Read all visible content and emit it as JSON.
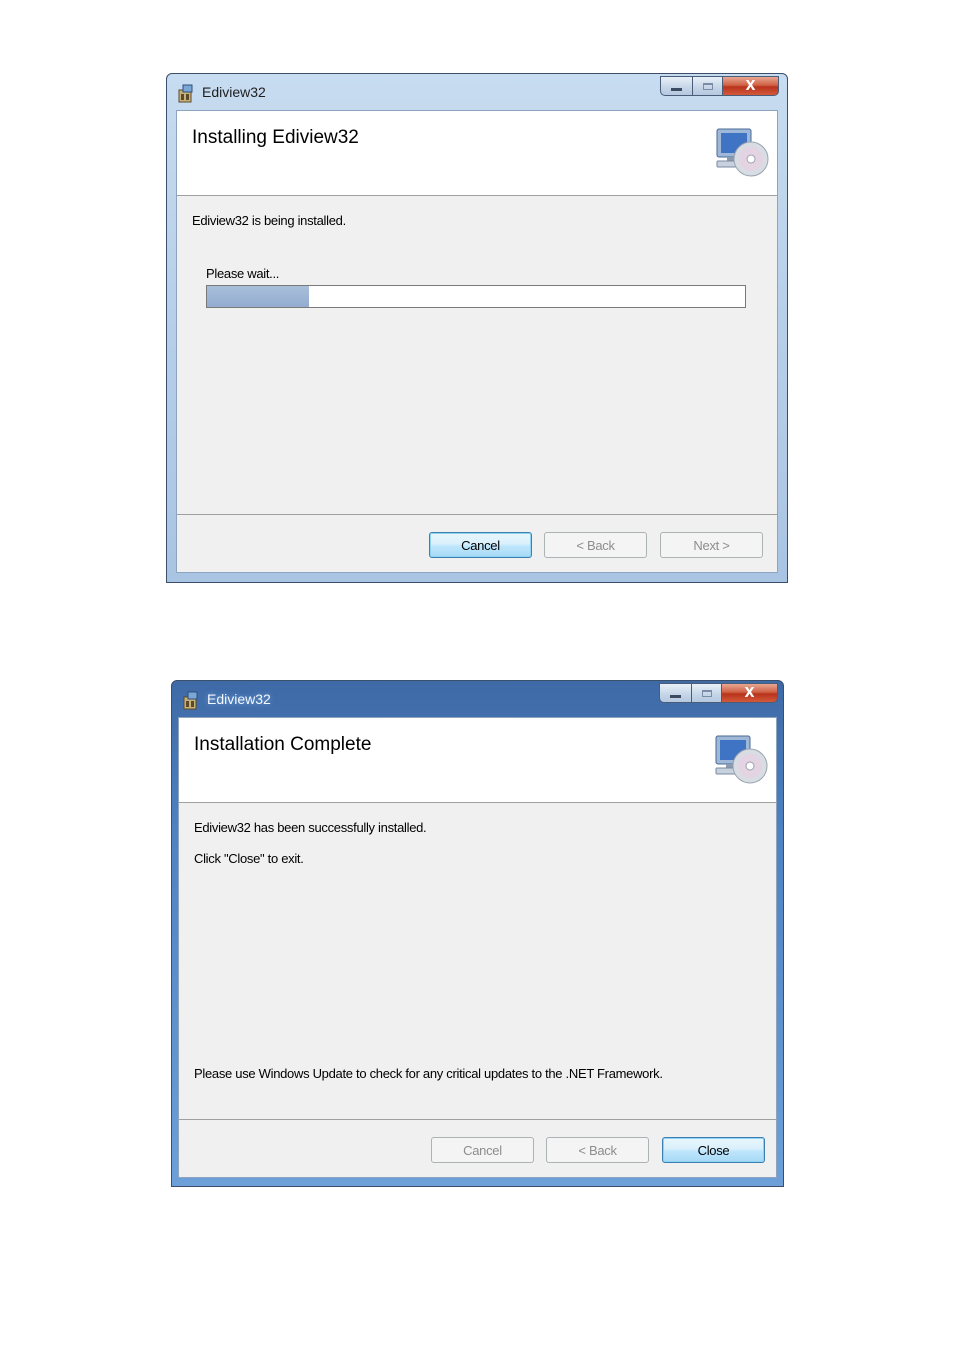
{
  "colors": {
    "progress_fill": "#93acd0",
    "close_button": "#c0391b",
    "client_background": "#f0f0f0"
  },
  "install_window": {
    "title": "Ediview32",
    "heading": "Installing Ediview32",
    "status": "Ediview32 is being installed.",
    "wait_label": "Please wait...",
    "progress_fraction": 0.19,
    "buttons": {
      "cancel": "Cancel",
      "back": "< Back",
      "next": "Next >"
    },
    "icons": [
      "installer-app-icon",
      "computer-with-disc-icon",
      "minimize-icon",
      "maximize-icon",
      "close-icon"
    ]
  },
  "complete_window": {
    "title": "Ediview32",
    "heading": "Installation Complete",
    "message": "Ediview32 has been successfully installed.",
    "instruction": "Click \"Close\" to exit.",
    "update_note": "Please use Windows Update to check for any critical updates to the .NET Framework.",
    "buttons": {
      "cancel": "Cancel",
      "back": "< Back",
      "close": "Close"
    },
    "icons": [
      "installer-app-icon",
      "computer-with-disc-icon",
      "minimize-icon",
      "maximize-icon",
      "close-icon"
    ]
  }
}
